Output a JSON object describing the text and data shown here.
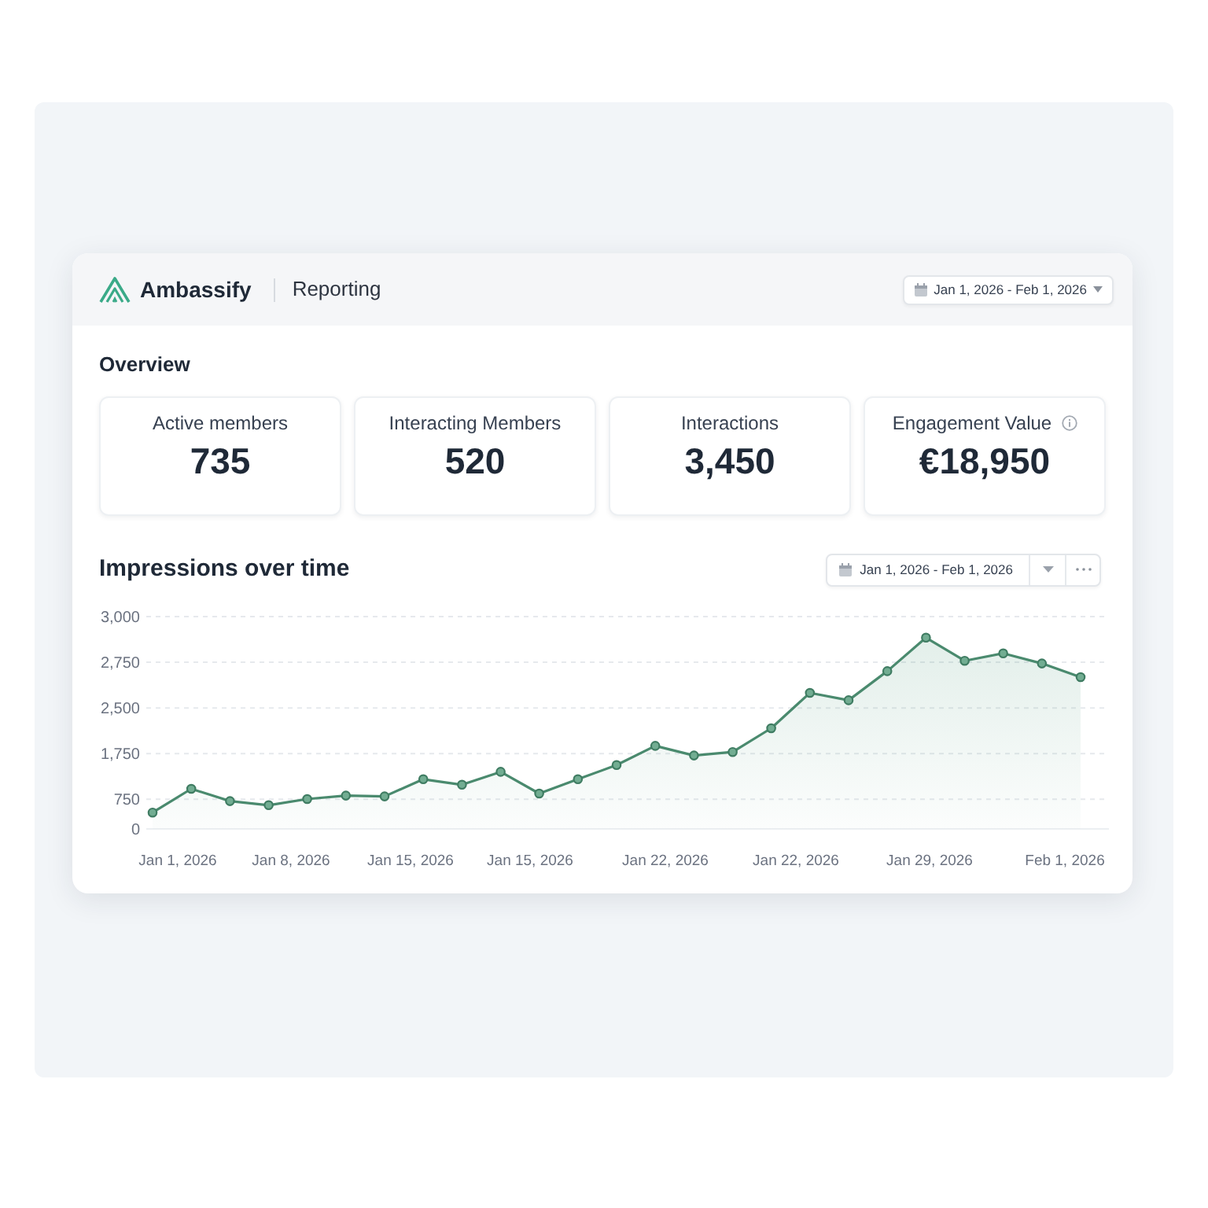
{
  "header": {
    "brand": "Ambassify",
    "section": "Reporting",
    "date_range": {
      "label": "Jan 1, 2026 - Feb 1, 2026"
    }
  },
  "overview": {
    "title": "Overview",
    "stats": [
      {
        "label": "Active members",
        "value": "735",
        "info": false
      },
      {
        "label": "Interacting Members",
        "value": "520",
        "info": false
      },
      {
        "label": "Interactions",
        "value": "3,450",
        "info": false
      },
      {
        "label": "Engagement Value",
        "value": "€18,950",
        "info": true
      }
    ]
  },
  "impressions": {
    "title": "Impressions over time",
    "date_range": {
      "label": "Jan 1, 2026 - Feb 1, 2026"
    },
    "chart": {
      "y_axis_labels": [
        "3,000",
        "2,750",
        "2,500",
        "1,750",
        "750",
        "0"
      ],
      "x_axis_labels": [
        "Jan 1, 2026",
        "Jan 8, 2026",
        "Jan 15, 2026",
        "Jan 15, 2026",
        "Jan 22, 2026",
        "Jan 22, 2026",
        "Jan 29, 2026",
        "Feb 1, 2026"
      ]
    }
  }
}
